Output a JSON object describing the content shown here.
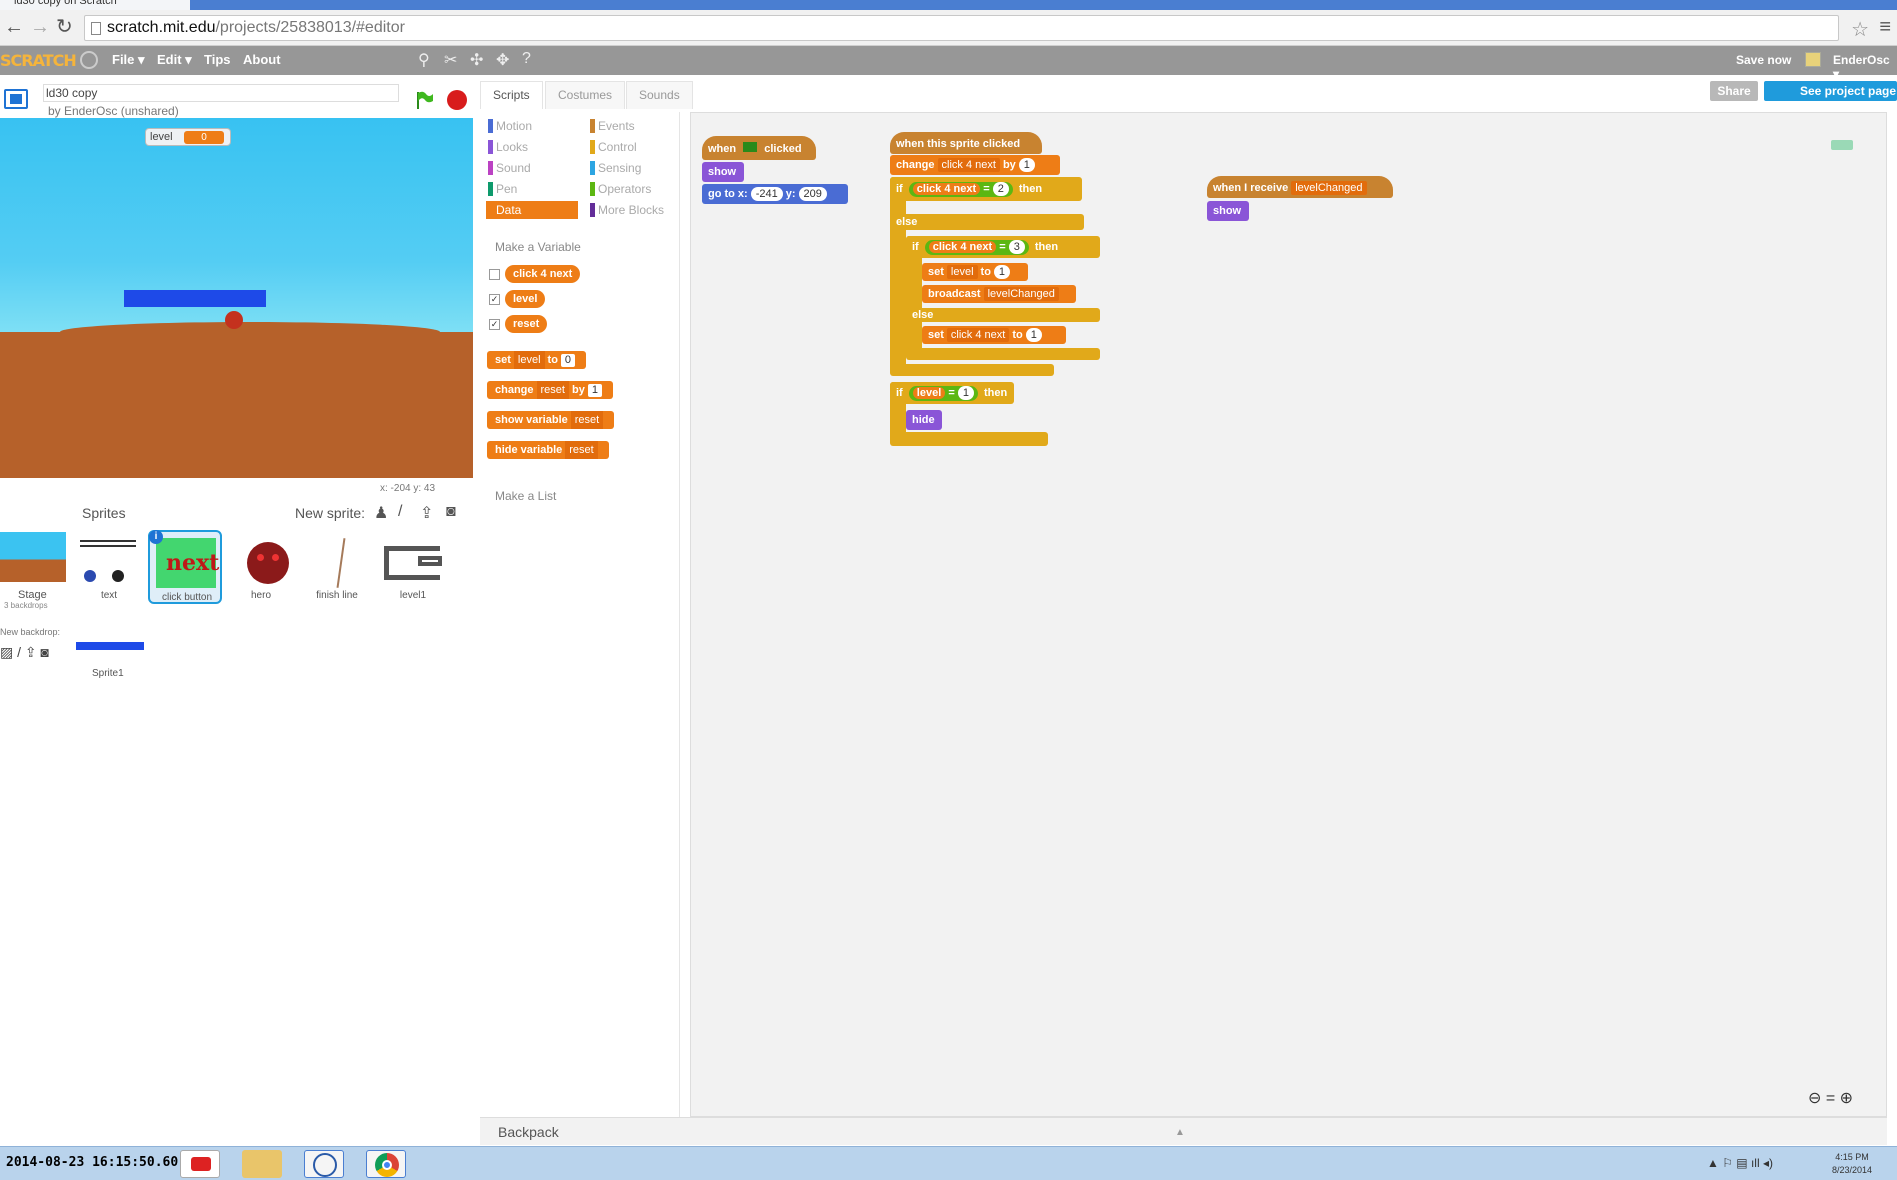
{
  "browser": {
    "tab_title": "ld30 copy on Scratch",
    "url_host": "scratch.mit.edu",
    "url_path": "/projects/25838013/#editor"
  },
  "menubar": {
    "logo": "SCRATCH",
    "file": "File ▾",
    "edit": "Edit ▾",
    "tips": "Tips",
    "about": "About",
    "save_now": "Save now",
    "user": "EnderOsc ▾"
  },
  "project": {
    "title": "ld30 copy",
    "byline": "by EnderOsc (unshared)",
    "share": "Share",
    "see_project_page": "See project page"
  },
  "tabs": [
    "Scripts",
    "Costumes",
    "Sounds"
  ],
  "stage": {
    "monitor_label": "level",
    "monitor_value": "0",
    "coords": "x: -204  y: 43"
  },
  "sprites_panel": {
    "title": "Sprites",
    "new_sprite": "New sprite:",
    "stage_label": "Stage",
    "stage_sub": "3 backdrops",
    "new_backdrop": "New backdrop:",
    "sprites": [
      {
        "name": "text"
      },
      {
        "name": "click button"
      },
      {
        "name": "hero"
      },
      {
        "name": "finish line"
      },
      {
        "name": "level1"
      },
      {
        "name": "Sprite1"
      }
    ]
  },
  "palette": {
    "categories_left": [
      "Motion",
      "Looks",
      "Sound",
      "Pen",
      "Data"
    ],
    "categories_right": [
      "Events",
      "Control",
      "Sensing",
      "Operators",
      "More Blocks"
    ],
    "colors": {
      "Motion": "#4a6cd4",
      "Looks": "#8a55d7",
      "Sound": "#bb42c3",
      "Pen": "#0e9a6c",
      "Data": "#ee7d16",
      "Events": "#c88330",
      "Control": "#e1a91a",
      "Sensing": "#2ca5e2",
      "Operators": "#5cb712",
      "More Blocks": "#632d99"
    },
    "make_variable": "Make a Variable",
    "variables": [
      "click 4 next",
      "level",
      "reset"
    ],
    "set_block": {
      "kw": "set",
      "var": "level",
      "to": "to",
      "val": "0"
    },
    "change_block": {
      "kw": "change",
      "var": "reset",
      "by": "by",
      "val": "1"
    },
    "show_var": {
      "kw": "show variable",
      "var": "reset"
    },
    "hide_var": {
      "kw": "hide variable",
      "var": "reset"
    },
    "make_list": "Make a List"
  },
  "scripts": {
    "s1": {
      "when": "when",
      "clicked": "clicked",
      "show": "show",
      "goto": "go to x:",
      "x": "-241",
      "y_lbl": "y:",
      "y": "209"
    },
    "s2": {
      "hat": "when this sprite clicked",
      "change": "change",
      "change_var": "click 4 next",
      "by": "by",
      "by_val": "1",
      "if": "if",
      "cond1_var": "click 4 next",
      "eq": "=",
      "cond1_val": "2",
      "then": "then",
      "else": "else",
      "cond2_var": "click 4 next",
      "cond2_val": "3",
      "set": "set",
      "set_var": "level",
      "to": "to",
      "set_val": "1",
      "broadcast": "broadcast",
      "broadcast_msg": "levelChanged",
      "set2_var": "click 4 next",
      "set2_val": "1",
      "cond3_var": "level",
      "cond3_val": "1",
      "hide": "hide"
    },
    "s3": {
      "hat": "when I receive",
      "msg": "levelChanged",
      "show": "show"
    }
  },
  "backpack": "Backpack",
  "taskbar": {
    "datetime": "2014-08-23 16:15:50.60",
    "clock_time": "4:15 PM",
    "clock_date": "8/23/2014"
  }
}
